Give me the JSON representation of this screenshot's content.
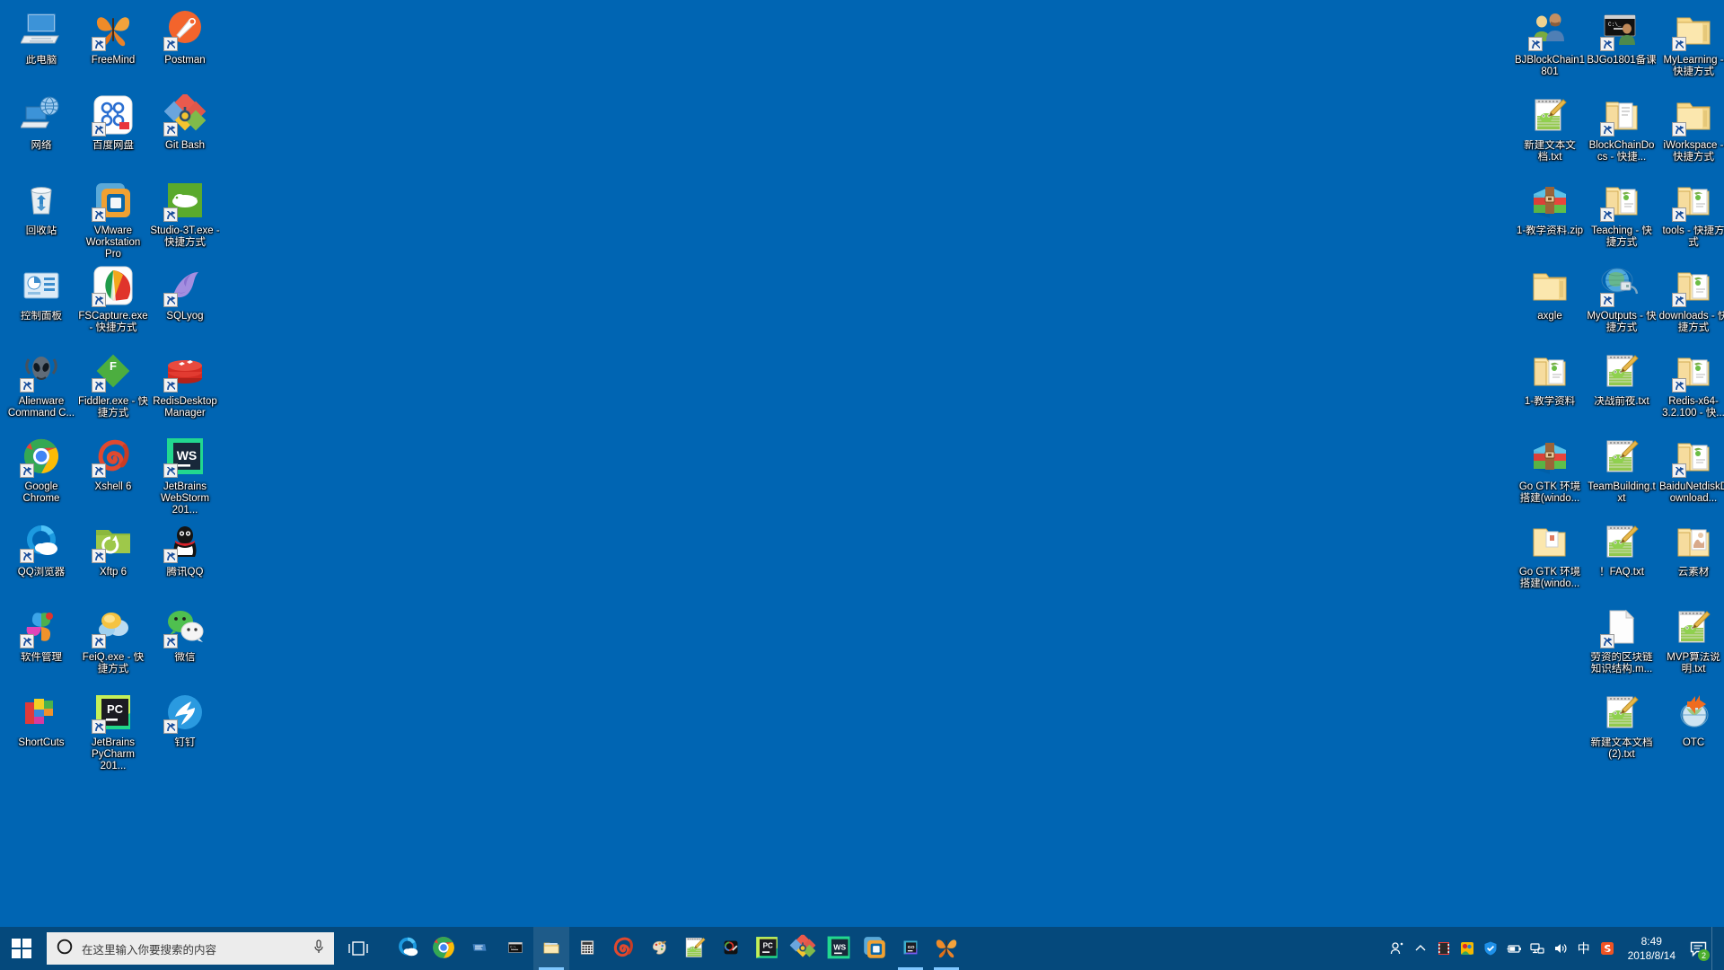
{
  "desktop": {
    "background_color": "#0065b3",
    "left_icons": [
      {
        "label": "此电脑",
        "icon": "this-pc-icon",
        "shortcut": false
      },
      {
        "label": "FreeMind",
        "icon": "freemind-butterfly-icon",
        "shortcut": true
      },
      {
        "label": "Postman",
        "icon": "postman-icon",
        "shortcut": true
      },
      {
        "label": "网络",
        "icon": "network-icon",
        "shortcut": false
      },
      {
        "label": "百度网盘",
        "icon": "baidu-netdisk-icon",
        "shortcut": true
      },
      {
        "label": "Git Bash",
        "icon": "git-bash-icon",
        "shortcut": true
      },
      {
        "label": "回收站",
        "icon": "recycle-bin-icon",
        "shortcut": false
      },
      {
        "label": "VMware Workstation Pro",
        "icon": "vmware-icon",
        "shortcut": true
      },
      {
        "label": "Studio-3T.exe - 快捷方式",
        "icon": "studio3t-icon",
        "shortcut": true
      },
      {
        "label": "控制面板",
        "icon": "control-panel-icon",
        "shortcut": false
      },
      {
        "label": "FSCapture.exe - 快捷方式",
        "icon": "fscapture-icon",
        "shortcut": true
      },
      {
        "label": "SQLyog",
        "icon": "sqlyog-dolphin-icon",
        "shortcut": true
      },
      {
        "label": "Alienware Command C...",
        "icon": "alienware-icon",
        "shortcut": true
      },
      {
        "label": "Fiddler.exe - 快捷方式",
        "icon": "fiddler-icon",
        "shortcut": true
      },
      {
        "label": "RedisDesktopManager",
        "icon": "redis-icon",
        "shortcut": true
      },
      {
        "label": "Google Chrome",
        "icon": "chrome-icon",
        "shortcut": true
      },
      {
        "label": "Xshell 6",
        "icon": "xshell-icon",
        "shortcut": true
      },
      {
        "label": "JetBrains WebStorm 201...",
        "icon": "webstorm-icon",
        "shortcut": true
      },
      {
        "label": "QQ浏览器",
        "icon": "qq-browser-icon",
        "shortcut": true
      },
      {
        "label": "Xftp 6",
        "icon": "xftp-icon",
        "shortcut": true
      },
      {
        "label": "腾讯QQ",
        "icon": "tencent-qq-icon",
        "shortcut": true
      },
      {
        "label": "软件管理",
        "icon": "software-manager-icon",
        "shortcut": true
      },
      {
        "label": "FeiQ.exe - 快捷方式",
        "icon": "feiq-icon",
        "shortcut": true
      },
      {
        "label": "微信",
        "icon": "wechat-icon",
        "shortcut": true
      },
      {
        "label": "ShortCuts",
        "icon": "shortcuts-folder-icon",
        "shortcut": false
      },
      {
        "label": "JetBrains PyCharm 201...",
        "icon": "pycharm-icon",
        "shortcut": true
      },
      {
        "label": "钉钉",
        "icon": "dingtalk-icon",
        "shortcut": true
      }
    ],
    "right_icons": [
      {
        "label": "BJBlockChain1801",
        "icon": "users-folder-icon",
        "shortcut": true
      },
      {
        "label": "BJGo1801备课",
        "icon": "console-user-icon",
        "shortcut": true
      },
      {
        "label": "MyLearning - 快捷方式",
        "icon": "folder-icon",
        "shortcut": true
      },
      {
        "label": "新建文本文档.txt",
        "icon": "notepad-text-icon",
        "shortcut": false
      },
      {
        "label": "BlockChainDocs - 快捷...",
        "icon": "folder-docs-icon",
        "shortcut": true
      },
      {
        "label": "iWorkspace - 快捷方式",
        "icon": "folder-icon",
        "shortcut": true
      },
      {
        "label": "1-教学资料.zip",
        "icon": "winrar-zip-icon",
        "shortcut": false
      },
      {
        "label": "Teaching - 快捷方式",
        "icon": "folder-open-icon",
        "shortcut": true
      },
      {
        "label": "tools - 快捷方式",
        "icon": "folder-open-icon",
        "shortcut": true
      },
      {
        "label": "axgle",
        "icon": "folder-icon",
        "shortcut": false
      },
      {
        "label": "MyOutputs - 快捷方式",
        "icon": "network-share-icon",
        "shortcut": true
      },
      {
        "label": "downloads - 快捷方式",
        "icon": "folder-open-icon",
        "shortcut": true
      },
      {
        "label": "1-教学资料",
        "icon": "folder-open-icon",
        "shortcut": false
      },
      {
        "label": "决战前夜.txt",
        "icon": "notepad-text-icon",
        "shortcut": false
      },
      {
        "label": "Redis-x64-3.2.100 - 快...",
        "icon": "folder-open-icon",
        "shortcut": true
      },
      {
        "label": "Go GTK 环境搭建(windo...",
        "icon": "winrar-zip-icon",
        "shortcut": false
      },
      {
        "label": "TeamBuilding.txt",
        "icon": "notepad-text-icon",
        "shortcut": false
      },
      {
        "label": "BaiduNetdiskDownload...",
        "icon": "folder-open-icon",
        "shortcut": true
      },
      {
        "label": "Go GTK 环境搭建(windo...",
        "icon": "folder-file-icon",
        "shortcut": false
      },
      {
        "label": "！FAQ.txt",
        "icon": "notepad-text-icon",
        "shortcut": false
      },
      {
        "label": "云素材",
        "icon": "folder-picture-icon",
        "shortcut": false
      },
      {
        "label": "",
        "icon": "blank",
        "shortcut": false
      },
      {
        "label": "劳资的区块链知识结构.m...",
        "icon": "plain-document-icon",
        "shortcut": true
      },
      {
        "label": "MVP算法说明.txt",
        "icon": "notepad-text-icon",
        "shortcut": false
      },
      {
        "label": "",
        "icon": "blank",
        "shortcut": false
      },
      {
        "label": "新建文本文档 (2).txt",
        "icon": "notepad-text-icon",
        "shortcut": false
      },
      {
        "label": "OTC",
        "icon": "otc-globe-icon",
        "shortcut": false
      }
    ]
  },
  "taskbar": {
    "start_label": "start-button",
    "search": {
      "placeholder": "在这里输入你要搜索的内容",
      "circle_icon": "cortana-circle-icon",
      "mic_icon": "microphone-icon"
    },
    "task_view_label": "task-view-button",
    "apps": [
      {
        "name": "qq-browser",
        "icon": "qq-browser-icon",
        "running": false,
        "active": false
      },
      {
        "name": "google-chrome",
        "icon": "chrome-icon",
        "running": false,
        "active": false
      },
      {
        "name": "ultraedit",
        "icon": "editor-icon",
        "running": false,
        "active": false
      },
      {
        "name": "cmd-console",
        "icon": "console-icon",
        "running": false,
        "active": false
      },
      {
        "name": "file-explorer",
        "icon": "file-explorer-icon",
        "running": true,
        "active": true
      },
      {
        "name": "calculator",
        "icon": "calculator-icon",
        "running": false,
        "active": false
      },
      {
        "name": "xshell",
        "icon": "xshell-icon",
        "running": false,
        "active": false
      },
      {
        "name": "paint",
        "icon": "paint-icon",
        "running": false,
        "active": false
      },
      {
        "name": "notepad-pp",
        "icon": "notepad-text-icon",
        "running": false,
        "active": false
      },
      {
        "name": "color-picker",
        "icon": "color-picker-icon",
        "running": false,
        "active": false
      },
      {
        "name": "pycharm",
        "icon": "pycharm-icon",
        "running": false,
        "active": false
      },
      {
        "name": "git-bash",
        "icon": "git-bash-icon",
        "running": false,
        "active": false
      },
      {
        "name": "webstorm",
        "icon": "webstorm-icon",
        "running": false,
        "active": false
      },
      {
        "name": "vmware",
        "icon": "vmware-icon",
        "running": false,
        "active": false
      },
      {
        "name": "goland",
        "icon": "goland-icon",
        "running": true,
        "active": false
      },
      {
        "name": "freemind",
        "icon": "freemind-butterfly-icon",
        "running": true,
        "active": false
      }
    ],
    "tray": {
      "people_icon": "people-icon",
      "chevron_icon": "chevron-up-icon",
      "icons": [
        {
          "name": "video-player-tray-icon"
        },
        {
          "name": "colorful-app-tray-icon"
        },
        {
          "name": "shield-security-tray-icon"
        },
        {
          "name": "battery-tray-icon"
        },
        {
          "name": "network-tray-icon"
        },
        {
          "name": "volume-tray-icon"
        }
      ],
      "ime_label": "中",
      "sogou_icon": "sogou-ime-icon"
    },
    "clock": {
      "time": "8:49",
      "date": "2018/8/14"
    },
    "action_center": {
      "icon": "action-center-icon",
      "badge": "2"
    }
  }
}
